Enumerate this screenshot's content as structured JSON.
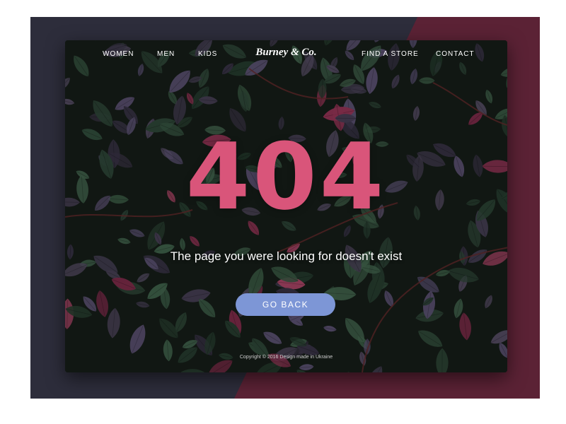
{
  "colors": {
    "page_background": "#ffffff",
    "backdrop_dark": "#2d2d3b",
    "backdrop_accent": "#5b2235",
    "error_code": "#d9557a",
    "button": "#7d96d6",
    "foliage_dark": "#141d16"
  },
  "header": {
    "nav_left": [
      {
        "label": "WOMEN"
      },
      {
        "label": "MEN"
      },
      {
        "label": "KIDS"
      }
    ],
    "brand": "Burney & Co.",
    "nav_right": [
      {
        "label": "FIND A STORE"
      },
      {
        "label": "CONTACT"
      }
    ]
  },
  "hero_image": "foliage-leaves-background",
  "error": {
    "code": "404",
    "message": "The page you were looking for doesn't exist"
  },
  "actions": {
    "go_back_label": "GO BACK"
  },
  "footer": {
    "copyright": "Copyright © 2016 Design made in Ukraine"
  }
}
